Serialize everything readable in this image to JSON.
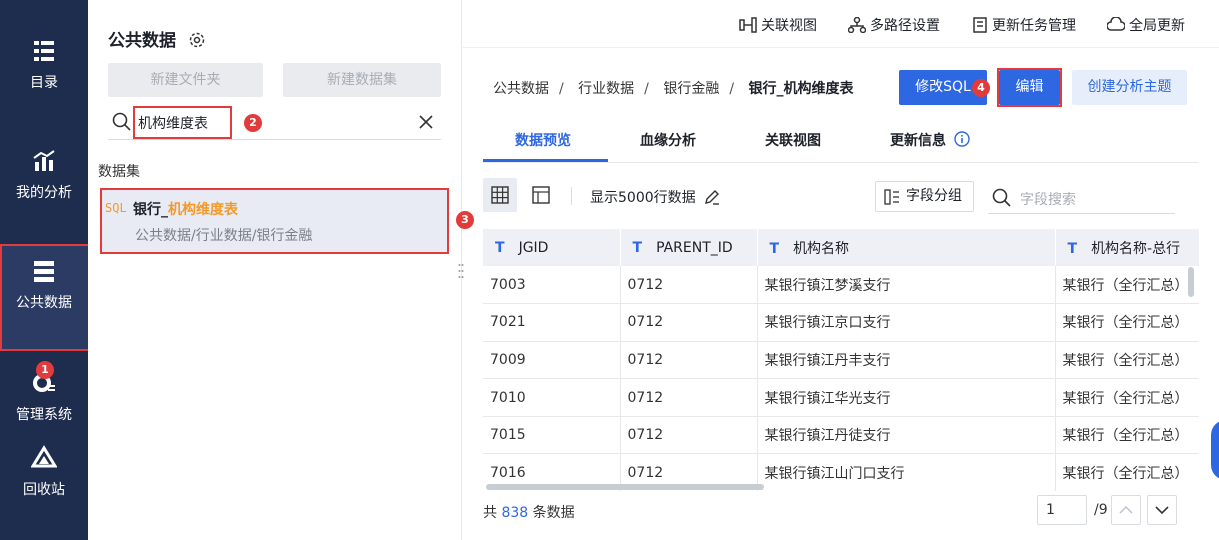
{
  "nav": {
    "items": [
      {
        "label": "目录",
        "icon": "catalog-icon"
      },
      {
        "label": "我的分析",
        "icon": "analysis-icon"
      },
      {
        "label": "公共数据",
        "icon": "public-data-icon"
      },
      {
        "label": "管理系统",
        "icon": "gear-icon"
      },
      {
        "label": "回收站",
        "icon": "recycle-icon"
      }
    ]
  },
  "badges": {
    "b1": "1",
    "b2": "2",
    "b3": "3",
    "b4": "4"
  },
  "panel": {
    "title": "公共数据",
    "new_folder": "新建文件夹",
    "new_dataset": "新建数据集",
    "search_value": "机构维度表",
    "section": "数据集",
    "item_prefix": "银行_",
    "item_highlight": "机构维度表",
    "item_path": "公共数据/行业数据/银行金融",
    "sql_tag": "SQL"
  },
  "topbar": {
    "link_view": "关联视图",
    "multipath": "多路径设置",
    "task_mgr": "更新任务管理",
    "global_update": "全局更新"
  },
  "breadcrumb": [
    "公共数据",
    "行业数据",
    "银行金融",
    "银行_机构维度表"
  ],
  "actions": {
    "modify_sql": "修改SQL",
    "edit": "编辑",
    "create_topic": "创建分析主题"
  },
  "tabs": [
    "数据预览",
    "血缘分析",
    "关联视图",
    "更新信息"
  ],
  "toolbar": {
    "show_rows": "显示5000行数据",
    "field_group": "字段分组",
    "field_search_placeholder": "字段搜索"
  },
  "table": {
    "type_marker": "T",
    "columns": [
      "JGID",
      "PARENT_ID",
      "机构名称",
      "机构名称-总行"
    ],
    "rows": [
      [
        "7003",
        "0712",
        "某银行镇江梦溪支行",
        "某银行（全行汇总）"
      ],
      [
        "7021",
        "0712",
        "某银行镇江京口支行",
        "某银行（全行汇总）"
      ],
      [
        "7009",
        "0712",
        "某银行镇江丹丰支行",
        "某银行（全行汇总）"
      ],
      [
        "7010",
        "0712",
        "某银行镇江华光支行",
        "某银行（全行汇总）"
      ],
      [
        "7015",
        "0712",
        "某银行镇江丹徒支行",
        "某银行（全行汇总）"
      ],
      [
        "7016",
        "0712",
        "某银行镇江山门口支行",
        "某银行（全行汇总）"
      ]
    ]
  },
  "footer": {
    "prefix": "共",
    "count": "838",
    "suffix": "条数据",
    "page": "1",
    "total_pages": "/9"
  }
}
